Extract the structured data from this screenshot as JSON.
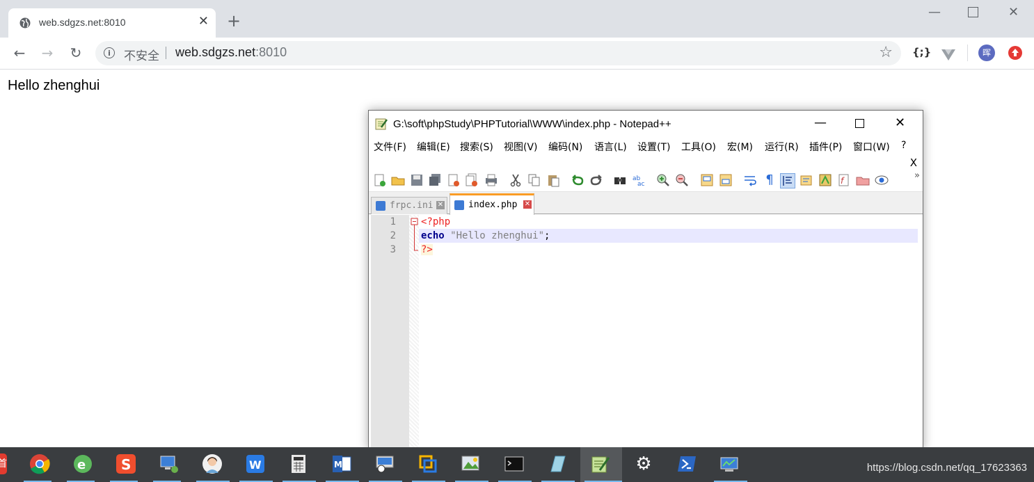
{
  "browser": {
    "tab_title": "web.sdgzs.net:8010",
    "tab_close": "✕",
    "new_tab": "+",
    "insecure_label": "不安全",
    "url_host": "web.sdgzs.net",
    "url_port": ":8010",
    "ext_json_label": "{;}",
    "avatar_label": "晖"
  },
  "page": {
    "text": "Hello zhenghui"
  },
  "notepad": {
    "title": "G:\\soft\\phpStudy\\PHPTutorial\\WWW\\index.php - Notepad++",
    "menu": [
      "文件(F)",
      "编辑(E)",
      "搜索(S)",
      "视图(V)",
      "编码(N)",
      "语言(L)",
      "设置(T)",
      "工具(O)",
      "宏(M)",
      "运行(R)",
      "插件(P)",
      "窗口(W)",
      "?"
    ],
    "close_x": "X",
    "more": "»",
    "tabs": [
      {
        "label": "frpc.ini",
        "active": false
      },
      {
        "label": "index.php",
        "active": true
      }
    ],
    "lines": [
      "1",
      "2",
      "3"
    ],
    "code": {
      "open_tag": "<?php",
      "echo_kw": "echo",
      "string": "\"Hello zhenghui\"",
      "semicolon": ";",
      "close_tag": "?>"
    }
  },
  "taskbar": {
    "watermark": "https://blog.csdn.net/qq_17623363",
    "left_edge_label": "首"
  }
}
